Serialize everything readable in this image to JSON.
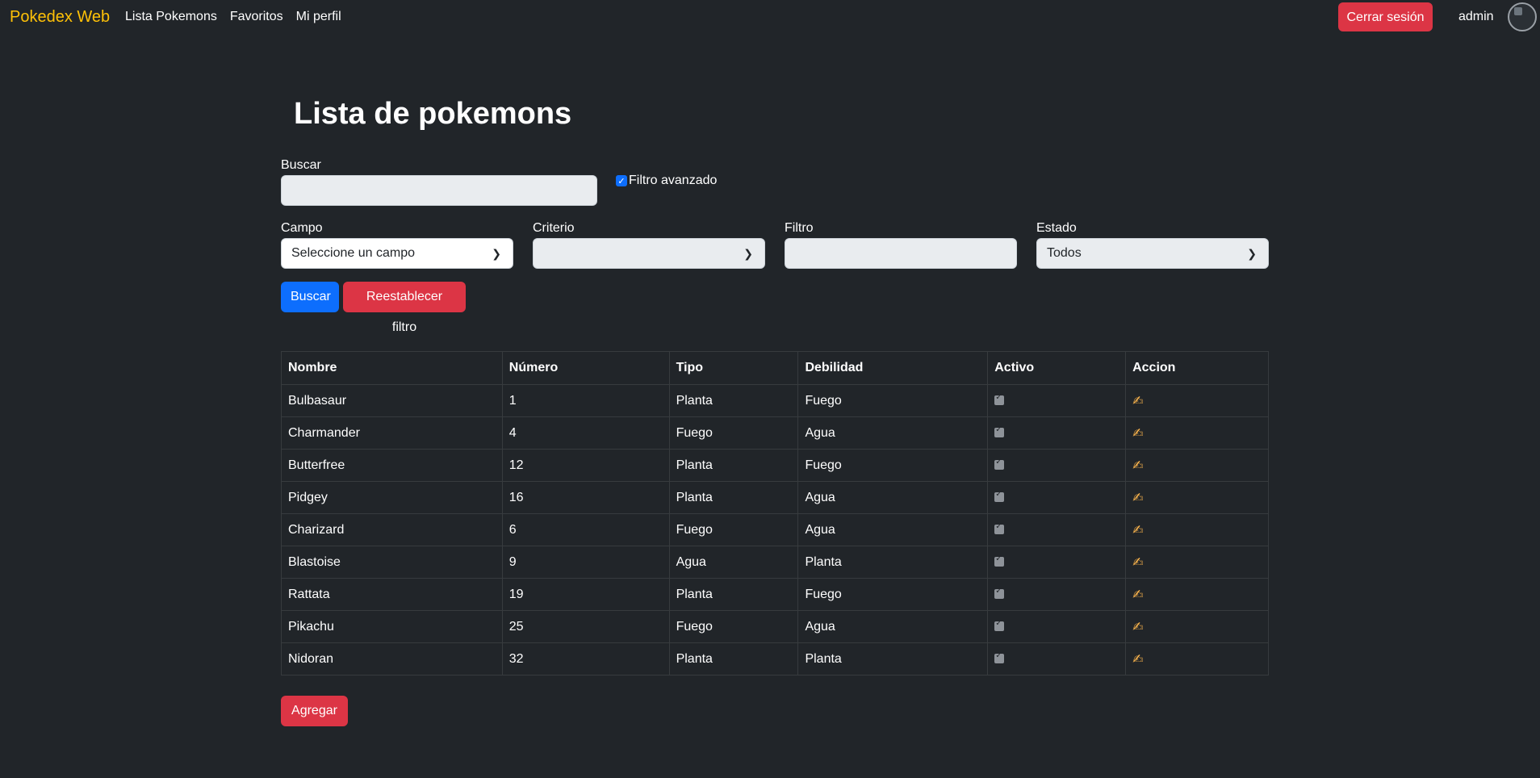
{
  "navbar": {
    "brand": "Pokedex Web",
    "links": [
      "Lista Pokemons",
      "Favoritos",
      "Mi perfil"
    ],
    "logout_label": "Cerrar sesión",
    "username": "admin"
  },
  "page": {
    "title": "Lista de pokemons",
    "search_label": "Buscar",
    "search_value": "",
    "advanced_filter_label": "Filtro avanzado",
    "advanced_filter_checked": true
  },
  "filters": {
    "campo_label": "Campo",
    "campo_value": "Seleccione un campo",
    "criterio_label": "Criterio",
    "criterio_value": "",
    "filtro_label": "Filtro",
    "filtro_value": "",
    "estado_label": "Estado",
    "estado_value": "Todos",
    "search_button": "Buscar",
    "reset_button": "Reestablecer filtro"
  },
  "table": {
    "headers": [
      "Nombre",
      "Número",
      "Tipo",
      "Debilidad",
      "Activo",
      "Accion"
    ],
    "rows": [
      {
        "nombre": "Bulbasaur",
        "numero": "1",
        "tipo": "Planta",
        "debilidad": "Fuego",
        "activo": true
      },
      {
        "nombre": "Charmander",
        "numero": "4",
        "tipo": "Fuego",
        "debilidad": "Agua",
        "activo": true
      },
      {
        "nombre": "Butterfree",
        "numero": "12",
        "tipo": "Planta",
        "debilidad": "Fuego",
        "activo": true
      },
      {
        "nombre": "Pidgey",
        "numero": "16",
        "tipo": "Planta",
        "debilidad": "Agua",
        "activo": true
      },
      {
        "nombre": "Charizard",
        "numero": "6",
        "tipo": "Fuego",
        "debilidad": "Agua",
        "activo": true
      },
      {
        "nombre": "Blastoise",
        "numero": "9",
        "tipo": "Agua",
        "debilidad": "Planta",
        "activo": true
      },
      {
        "nombre": "Rattata",
        "numero": "19",
        "tipo": "Planta",
        "debilidad": "Fuego",
        "activo": true
      },
      {
        "nombre": "Pikachu",
        "numero": "25",
        "tipo": "Fuego",
        "debilidad": "Agua",
        "activo": true
      },
      {
        "nombre": "Nidoran",
        "numero": "32",
        "tipo": "Planta",
        "debilidad": "Planta",
        "activo": true
      }
    ],
    "action_icon": "✍"
  },
  "add_button": "Agregar"
}
